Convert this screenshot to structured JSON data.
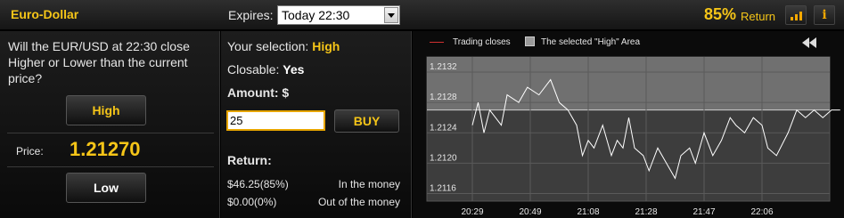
{
  "header": {
    "asset": "Euro-Dollar",
    "expires_label": "Expires:",
    "expiry_value": "Today 22:30",
    "return_pct": "85%",
    "return_label": "Return",
    "icons": [
      "bar-chart-icon",
      "info-icon"
    ],
    "info_glyph": "i"
  },
  "left": {
    "question": "Will the EUR/USD at 22:30 close Higher or Lower than the current price?",
    "high_label": "High",
    "price_label": "Price:",
    "price_value": "1.21270",
    "low_label": "Low"
  },
  "middle": {
    "selection_label": "Your selection:",
    "selection_value": "High",
    "closable_label": "Closable:",
    "closable_value": "Yes",
    "amount_label": "Amount: $",
    "amount_value": "25",
    "buy_label": "BUY",
    "return_heading": "Return:",
    "return_rows": [
      {
        "amount": "$46.25",
        "pct": "(85%)",
        "status": "In the money"
      },
      {
        "amount": "$0.00",
        "pct": "(0%)",
        "status": "Out of the money"
      }
    ]
  },
  "chart_legend": {
    "trading_closes": "Trading closes",
    "high_area": "The selected \"High\" Area"
  },
  "colors": {
    "accent": "#f5c518",
    "close_line": "#d03030",
    "high_area": "#9a9a9a",
    "price_line": "#ffffff"
  },
  "chart_data": {
    "type": "line",
    "x_ticks": [
      "20:29",
      "20:49",
      "21:08",
      "21:28",
      "21:47",
      "22:06"
    ],
    "y_ticks": [
      "1.2132",
      "1.2128",
      "1.2124",
      "1.2120",
      "1.2116"
    ],
    "y_range": [
      1.2115,
      1.2134
    ],
    "x_range": [
      0,
      6
    ],
    "current_price": 1.2127,
    "trading_close_x": 6.8,
    "grid": true,
    "series": [
      {
        "x": [
          0,
          0.1,
          0.2,
          0.3,
          0.5,
          0.6,
          0.8,
          0.95,
          1.15,
          1.35,
          1.5,
          1.65,
          1.8,
          1.9,
          2.0,
          2.1,
          2.25,
          2.4,
          2.5,
          2.6,
          2.7,
          2.8,
          2.95,
          3.05,
          3.2,
          3.35,
          3.5,
          3.6,
          3.75,
          3.85,
          4.0,
          4.15,
          4.3,
          4.45,
          4.55,
          4.7,
          4.85,
          5.0,
          5.1,
          5.25,
          5.45,
          5.6,
          5.75,
          5.9,
          6.05,
          6.2,
          6.35
        ],
        "y": [
          1.2125,
          1.2128,
          1.2124,
          1.2127,
          1.2125,
          1.2129,
          1.2128,
          1.213,
          1.2129,
          1.2131,
          1.2128,
          1.2127,
          1.2125,
          1.2121,
          1.2123,
          1.2122,
          1.2125,
          1.2121,
          1.2123,
          1.2122,
          1.2126,
          1.2122,
          1.2121,
          1.2119,
          1.2122,
          1.212,
          1.2118,
          1.2121,
          1.2122,
          1.212,
          1.2124,
          1.2121,
          1.2123,
          1.2126,
          1.2125,
          1.2124,
          1.2126,
          1.2125,
          1.2122,
          1.2121,
          1.2124,
          1.2127,
          1.2126,
          1.2127,
          1.2126,
          1.2127,
          1.2127
        ]
      }
    ]
  }
}
